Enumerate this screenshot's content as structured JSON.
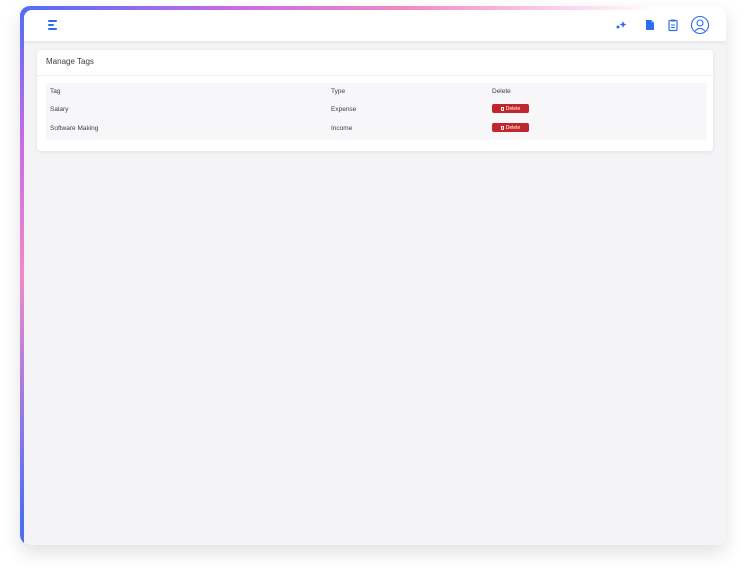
{
  "topbar": {
    "menu_icon": "menu-icon",
    "icons": [
      "magic-sparkle-icon",
      "file-icon",
      "clipboard-icon",
      "user-avatar-icon"
    ],
    "accent": "#2d6cf5"
  },
  "card": {
    "title": "Manage Tags",
    "table": {
      "headers": {
        "tag": "Tag",
        "type": "Type",
        "delete": "Delete"
      },
      "rows": [
        {
          "tag": "Salary",
          "type": "Expense",
          "delete_label": "Delete"
        },
        {
          "tag": "Software Making",
          "type": "Income",
          "delete_label": "Delete"
        }
      ]
    }
  },
  "colors": {
    "delete_button": "#c0262c",
    "background": "#f4f4f7"
  }
}
